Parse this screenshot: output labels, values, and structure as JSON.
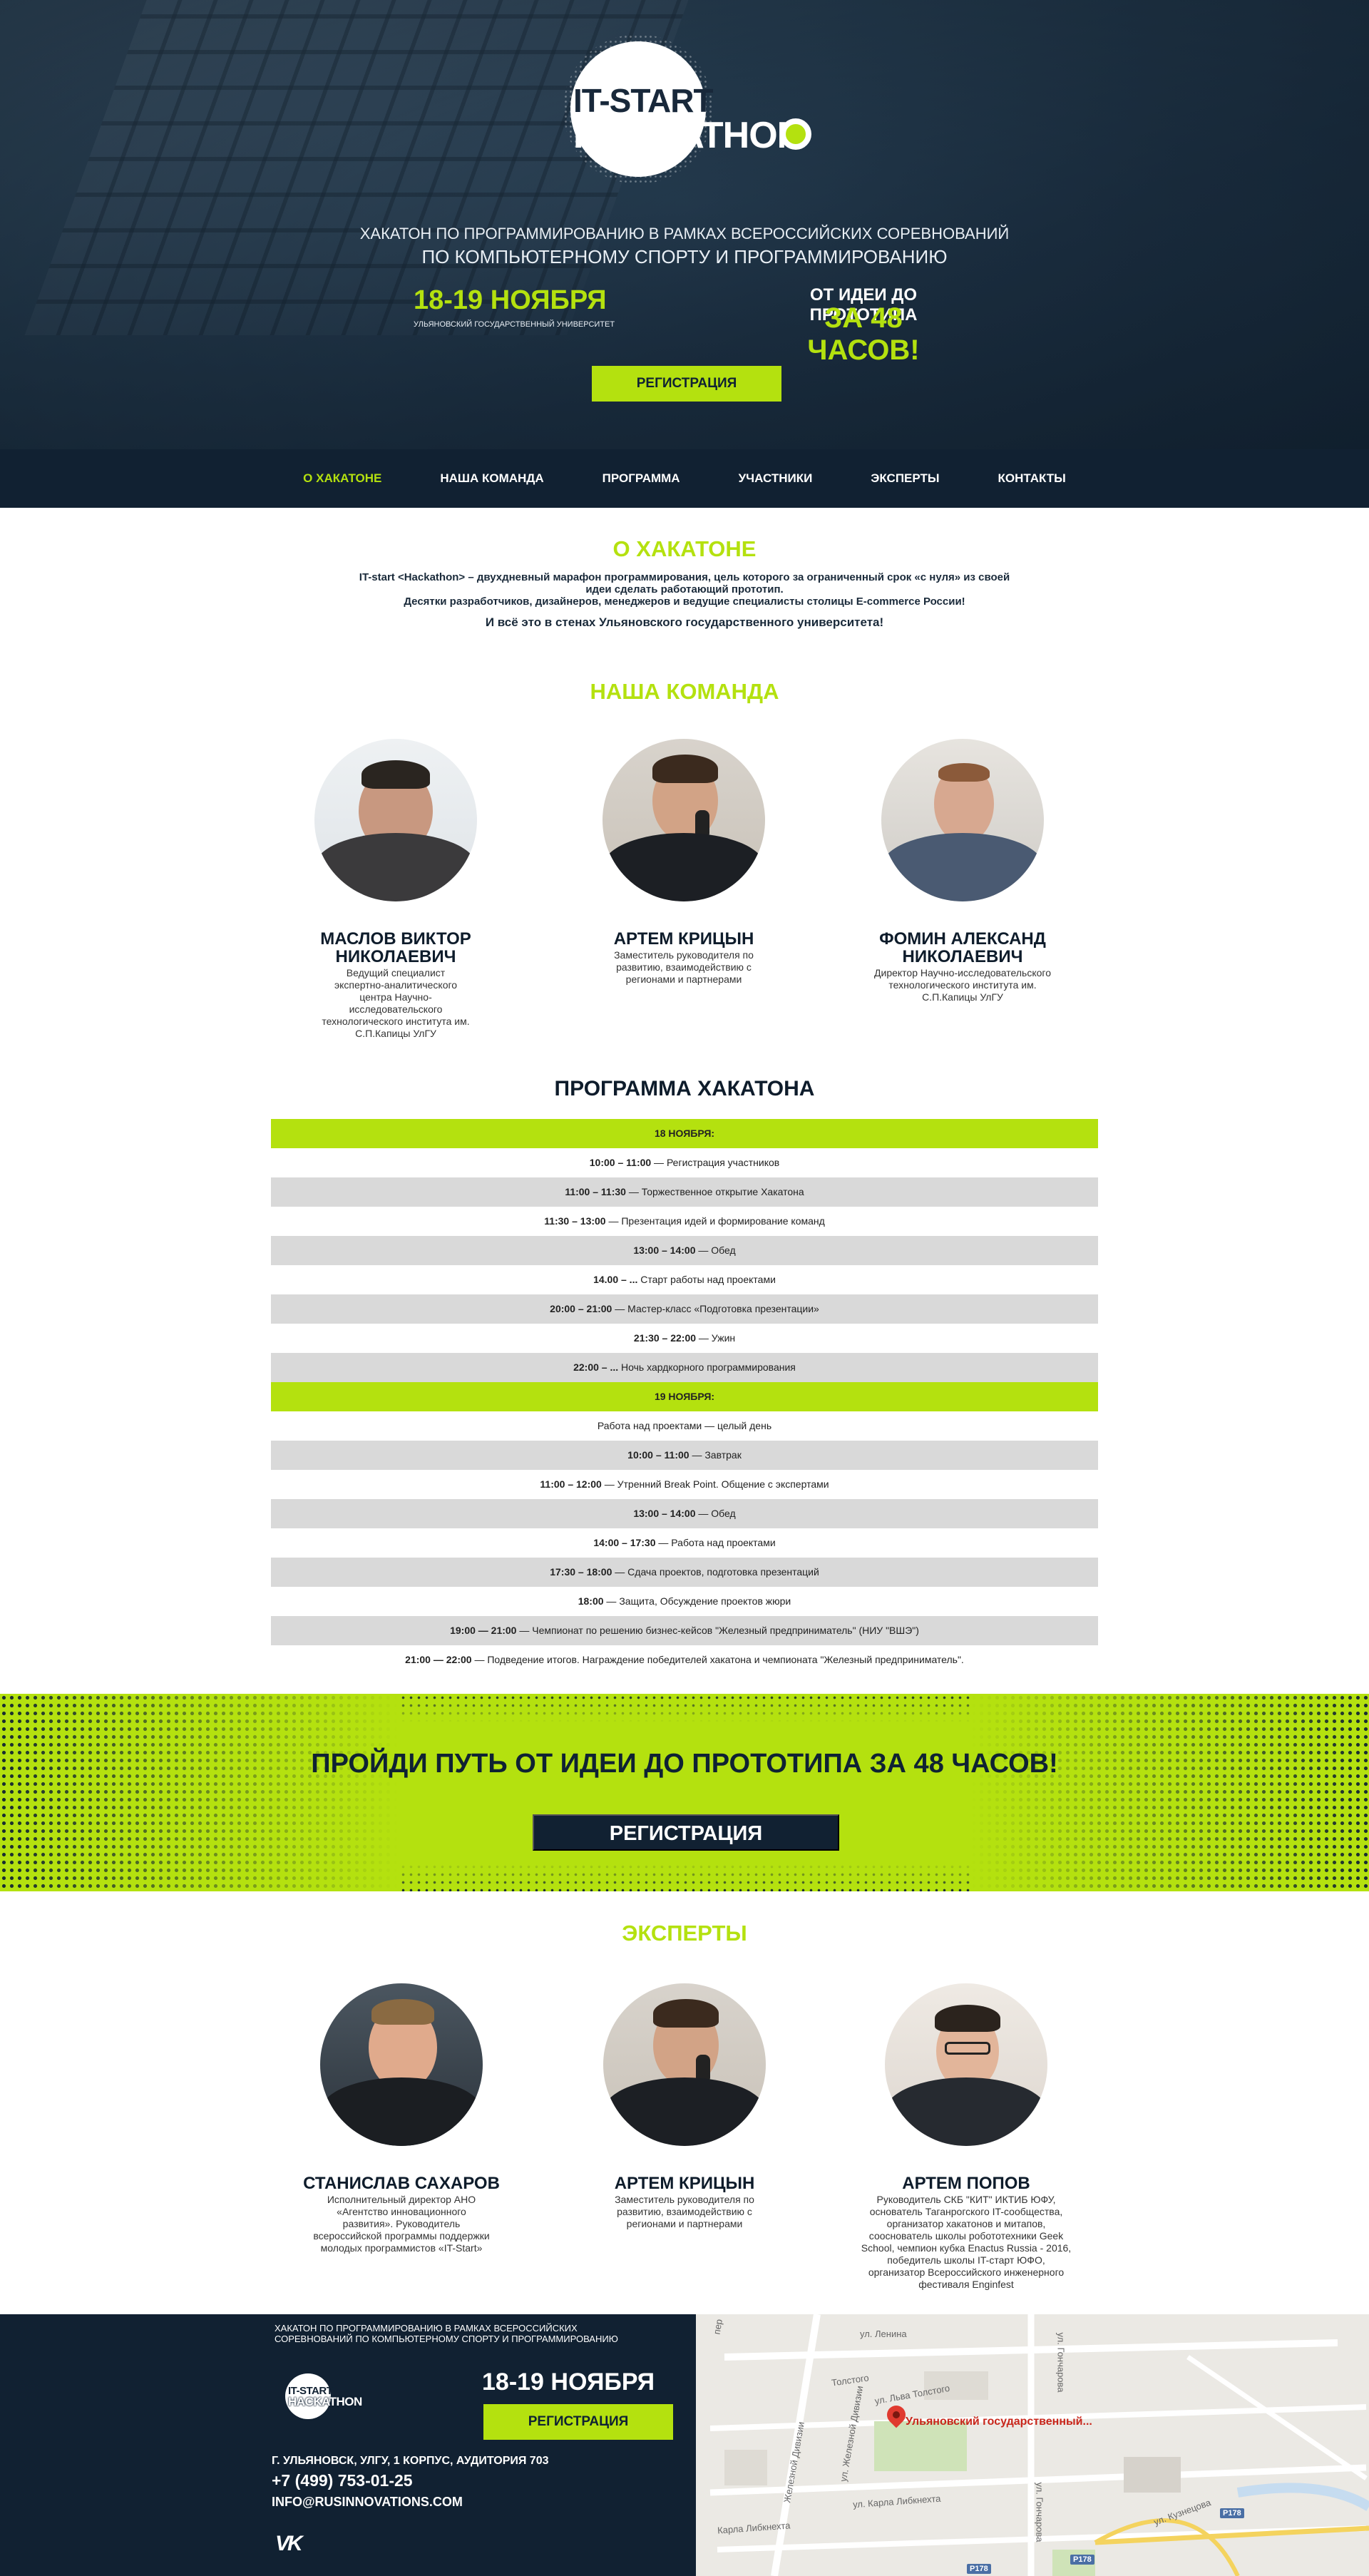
{
  "hero": {
    "logo_line1": "IT-START",
    "logo_line2": "HACKATHON",
    "subtitle_line1": "ХАКАТОН ПО ПРОГРАММИРОВАНИЮ В РАМКАХ ВСЕРОССИЙСКИХ СОРЕВНОВАНИЙ",
    "subtitle_line2": "ПО КОМПЬЮТЕРНОМУ СПОРТУ И ПРОГРАММИРОВАНИЮ",
    "date": "18-19 НОЯБРЯ",
    "university": "УЛЬЯНОВСКИЙ ГОСУДАРСТВЕННЫЙ УНИВЕРСИТЕТ",
    "idea_line1": "ОТ ИДЕИ ДО ПРОТОТИПА",
    "idea_line2": "ЗА 48 ЧАСОВ!",
    "register_label": "РЕГИСТРАЦИЯ"
  },
  "nav": {
    "items": [
      {
        "label": "О ХАКАТОНЕ",
        "active": true
      },
      {
        "label": "НАША КОМАНДА",
        "active": false
      },
      {
        "label": "ПРОГРАММА",
        "active": false
      },
      {
        "label": "УЧАСТНИКИ",
        "active": false
      },
      {
        "label": "ЭКСПЕРТЫ",
        "active": false
      },
      {
        "label": "КОНТАКТЫ",
        "active": false
      }
    ]
  },
  "about": {
    "title": "О ХАКАТОНЕ",
    "line1": "IT-start <Hackathon> – двухдневный марафон программирования, цель которого за ограниченный срок «с нуля» из своей",
    "line2": "идеи сделать работающий прототип.",
    "line3": "Десятки разработчиков, дизайнеров, менеджеров и ведущие специалисты столицы E-commerce России!",
    "line4": "И всё это в стенах Ульяновского государственного университета!"
  },
  "team": {
    "title": "НАША КОМАНДА",
    "members": [
      {
        "name": "МАСЛОВ ВИКТОР НИКОЛАЕВИЧ",
        "desc": "Ведущий специалист экспертно-аналитического центра Научно-исследовательского технологического института им. С.П.Капицы УлГУ"
      },
      {
        "name": "АРТЕМ КРИЦЫН",
        "desc": "Заместитель руководителя по развитию, взаимодействию с регионами и партнерами"
      },
      {
        "name": "ФОМИН АЛЕКСАНД НИКОЛАЕВИЧ",
        "desc": "Директор Научно-исследовательского технологического института им. С.П.Капицы УлГУ"
      }
    ]
  },
  "program": {
    "title": "ПРОГРАММА ХАКАТОНА",
    "rows": [
      {
        "type": "day",
        "time": "",
        "text": "18 НОЯБРЯ:"
      },
      {
        "type": "white",
        "time": "10:00 – 11:00",
        "text": " — Регистрация участников"
      },
      {
        "type": "grey",
        "time": "11:00 – 11:30",
        "text": " — Торжественное открытие Хакатона"
      },
      {
        "type": "white",
        "time": "11:30 – 13:00",
        "text": " — Презентация идей и формирование команд"
      },
      {
        "type": "grey",
        "time": "13:00 – 14:00",
        "text": " — Обед"
      },
      {
        "type": "white",
        "time": "14.00 – ...",
        "text": " Старт работы над проектами"
      },
      {
        "type": "grey",
        "time": "20:00 – 21:00",
        "text": " — Мастер-класс «Подготовка презентации»"
      },
      {
        "type": "white",
        "time": "21:30 – 22:00",
        "text": " — Ужин"
      },
      {
        "type": "grey",
        "time": "22:00 – ...",
        "text": " Ночь хардкорного программирования"
      },
      {
        "type": "day",
        "time": "",
        "text": "19 НОЯБРЯ:"
      },
      {
        "type": "white",
        "time": "",
        "text": "Работа над проектами — целый день"
      },
      {
        "type": "grey",
        "time": "10:00 – 11:00",
        "text": " — Завтрак"
      },
      {
        "type": "white",
        "time": "11:00 – 12:00",
        "text": " — Утренний Break Point. Общение с экспертами"
      },
      {
        "type": "grey",
        "time": "13:00 – 14:00",
        "text": " — Обед"
      },
      {
        "type": "white",
        "time": "14:00 – 17:30",
        "text": "  — Работа над проектами"
      },
      {
        "type": "grey",
        "time": "17:30 – 18:00",
        "text": " — Сдача проектов, подготовка презентаций"
      },
      {
        "type": "white",
        "time": "18:00",
        "text": " — Защита, Обсуждение проектов жюри"
      },
      {
        "type": "grey",
        "time": "19:00 — 21:00",
        "text": " — Чемпионат по решению бизнес-кейсов  \"Железный предприниматель\" (НИУ \"ВШЭ\")"
      },
      {
        "type": "white",
        "time": "21:00 — 22:00",
        "text": " — Подведение итогов. Награждение победителей хакатона и чемпионата \"Железный предприниматель\"."
      }
    ]
  },
  "cta": {
    "text": "ПРОЙДИ ПУТЬ ОТ ИДЕИ ДО ПРОТОТИПА ЗА 48 ЧАСОВ!",
    "button": "РЕГИСТРАЦИЯ"
  },
  "experts": {
    "title": "ЭКСПЕРТЫ",
    "members": [
      {
        "name": "СТАНИСЛАВ САХАРОВ",
        "desc": "Исполнительный директор АНО «Агентство инновационного развития». Руководитель всероссийской программы поддержки молодых программистов «IT-Start»"
      },
      {
        "name": "АРТЕМ КРИЦЫН",
        "desc": "Заместитель руководителя по развитию, взаимодействию с регионами и партнерами"
      },
      {
        "name": "АРТЕМ ПОПОВ",
        "desc": "Руководитель СКБ \"КИТ\" ИКТИБ ЮФУ, основатель Таганрогского IT-сообщества, организатор хакатонов и митапов, сооснователь школы робототехники Geek School, чемпион кубка Enactus Russia - 2016, победитель школы IT-старт ЮФО, организатор Всероссийского инженерного фестиваля Enginfest"
      }
    ]
  },
  "footer": {
    "subtitle": "ХАКАТОН ПО ПРОГРАММИРОВАНИЮ В РАМКАХ ВСЕРОССИЙСКИХ СОРЕВНОВАНИЙ ПО КОМПЬЮТЕРНОМУ СПОРТУ И ПРОГРАММИРОВАНИЮ",
    "logo_line1": "IT-START",
    "logo_line2": "HACKATHON",
    "date": "18-19 НОЯБРЯ",
    "register": "РЕГИСТРАЦИЯ",
    "address": "Г. УЛЬЯНОВСК, УЛГУ, 1 КОРПУС, АУДИТОРИЯ 703",
    "phone": "+7 (499) 753-01-25",
    "email": "INFO@RUSINNOVATIONS.COM",
    "vk": "VK"
  },
  "map": {
    "pin_label": "Ульяновский государственный...",
    "streets": [
      "ул. Ленина",
      "ул. Гончарова",
      "Толстого",
      "ул. Льва Толстого",
      "Железной Дивизии",
      "ул. Железной Дивизии",
      "ул. Карла Либкнехта",
      "Карла Либкнехта",
      "ул. Кузнецова",
      "ул. Гончарова",
      "Р178",
      "Р178",
      "Р178",
      "пер"
    ]
  },
  "colors": {
    "accent": "#b4e10f",
    "navy": "#112132"
  }
}
